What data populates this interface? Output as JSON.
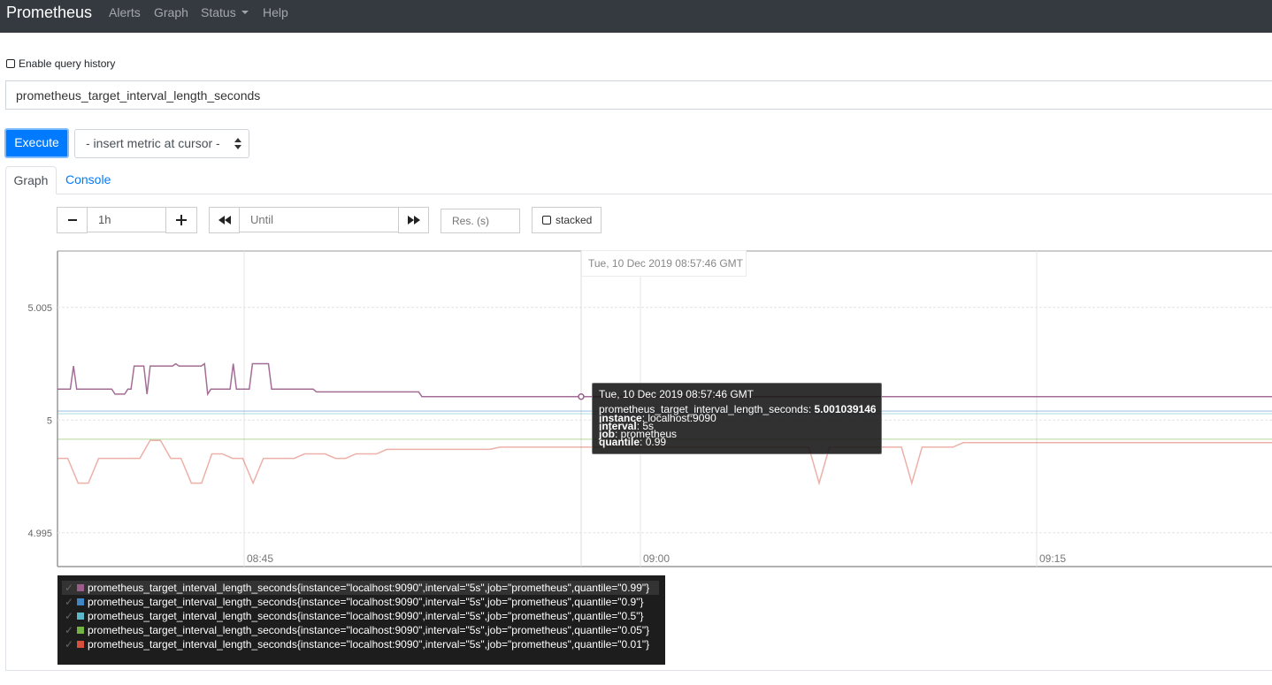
{
  "navbar": {
    "brand": "Prometheus",
    "items": [
      "Alerts",
      "Graph",
      "Status",
      "Help"
    ],
    "bg_color": "#343a40"
  },
  "query": {
    "history_label": "Enable query history",
    "history_checked": false,
    "expression": "prometheus_target_interval_length_seconds",
    "execute_label": "Execute",
    "insert_metric_label": "- insert metric at cursor -"
  },
  "tabs": [
    "Graph",
    "Console"
  ],
  "controls": {
    "range": "1h",
    "until_placeholder": "Until",
    "res_placeholder": "Res. (s)",
    "stacked_label": "stacked"
  },
  "hover_time": "Tue, 10 Dec 2019 08:57:46 GMT",
  "tooltip": {
    "time": "Tue, 10 Dec 2019 08:57:46 GMT",
    "metric": "prometheus_target_interval_length_seconds",
    "value": "5.001039146",
    "labels": [
      {
        "key": "instance",
        "value": "localhost:9090"
      },
      {
        "key": "interval",
        "value": "5s"
      },
      {
        "key": "job",
        "value": "prometheus"
      },
      {
        "key": "quantile",
        "value": "0.99"
      }
    ]
  },
  "legend": [
    {
      "label": "prometheus_target_interval_length_seconds{instance=\"localhost:9090\",interval=\"5s\",job=\"prometheus\",quantile=\"0.99\"}",
      "color": "#9a5d8a"
    },
    {
      "label": "prometheus_target_interval_length_seconds{instance=\"localhost:9090\",interval=\"5s\",job=\"prometheus\",quantile=\"0.9\"}",
      "color": "#3f86c5"
    },
    {
      "label": "prometheus_target_interval_length_seconds{instance=\"localhost:9090\",interval=\"5s\",job=\"prometheus\",quantile=\"0.5\"}",
      "color": "#5bb8c8"
    },
    {
      "label": "prometheus_target_interval_length_seconds{instance=\"localhost:9090\",interval=\"5s\",job=\"prometheus\",quantile=\"0.05\"}",
      "color": "#74b243"
    },
    {
      "label": "prometheus_target_interval_length_seconds{instance=\"localhost:9090\",interval=\"5s\",job=\"prometheus\",quantile=\"0.01\"}",
      "color": "#d6503e"
    }
  ],
  "chart_data": {
    "type": "line",
    "y_ticks": [
      "5.005",
      "5",
      "4.995"
    ],
    "x_ticks": [
      "08:45",
      "09:00",
      "09:15"
    ],
    "ylim": [
      4.9935,
      5.0075
    ],
    "grid": true,
    "series": [
      {
        "name": "quantile=\"0.99\"",
        "color": "#9a5d8a",
        "values": [
          5.00137,
          5.00137,
          5.00137,
          5.00137,
          5.00137,
          5.0024,
          5.00137,
          5.00137,
          5.00137,
          5.00137,
          5.00137,
          5.00137,
          5.00137,
          5.00137,
          5.00137,
          5.00137,
          5.00137,
          5.00137,
          5.00115,
          5.00115,
          5.00115,
          5.00115,
          5.00137,
          5.00137,
          5.0024,
          5.0024,
          5.0024,
          5.0024,
          5.00115,
          5.0024,
          5.0024,
          5.0024,
          5.0024,
          5.0024,
          5.0024,
          5.0024,
          5.0024,
          5.0025,
          5.0024,
          5.0024,
          5.0024,
          5.0024,
          5.0024,
          5.0024,
          5.0024,
          5.0024,
          5.0025,
          5.00115,
          5.00137,
          5.00137,
          5.00137,
          5.00137,
          5.00137,
          5.00137,
          5.00137,
          5.0025,
          5.00137,
          5.00137,
          5.00137,
          5.00137,
          5.00137,
          5.0025,
          5.0025,
          5.0025,
          5.0025,
          5.0025,
          5.0025,
          5.00137,
          5.00137,
          5.00137,
          5.00137,
          5.00137,
          5.00137,
          5.00137,
          5.00137,
          5.00137,
          5.00137,
          5.00137,
          5.00137,
          5.00137,
          5.00137,
          5.00125,
          5.00125,
          5.00125,
          5.00125,
          5.00125,
          5.00125,
          5.00125,
          5.00125,
          5.00125,
          5.00125,
          5.00125,
          5.00125,
          5.00125,
          5.00125,
          5.00125,
          5.00125,
          5.00125,
          5.00125,
          5.00125,
          5.00125,
          5.00125,
          5.00125,
          5.00125,
          5.00125,
          5.00125,
          5.00125,
          5.00125,
          5.00125,
          5.00125,
          5.00125,
          5.00125,
          5.00125,
          5.00125,
          5.00104,
          5.00104,
          5.00104,
          5.00104,
          5.00104,
          5.00104,
          5.00104,
          5.00104,
          5.00104,
          5.00104,
          5.00104,
          5.00104,
          5.00104,
          5.00104,
          5.00104,
          5.00104,
          5.00104,
          5.00104,
          5.00104,
          5.00104,
          5.00104,
          5.00104,
          5.00104,
          5.00104,
          5.00104,
          5.00104,
          5.00104,
          5.00104,
          5.00104,
          5.00104,
          5.00104,
          5.00104,
          5.00104,
          5.00104,
          5.00104,
          5.00104,
          5.00104,
          5.00104,
          5.00104,
          5.00104,
          5.00104,
          5.00104,
          5.00104,
          5.00104,
          5.00104,
          5.00104,
          5.00104,
          5.00104,
          5.00104,
          5.00104,
          5.00104,
          5.00104,
          5.00104,
          5.00104,
          5.00104,
          5.00104,
          5.00104,
          5.00104,
          5.00104,
          5.00104,
          5.00104,
          5.00104,
          5.00104,
          5.00104,
          5.00104,
          5.00104,
          5.00104,
          5.00104,
          5.00104,
          5.00104,
          5.00104,
          5.00104,
          5.00104,
          5.00104,
          5.00104,
          5.00104,
          5.00104,
          5.00104,
          5.00104,
          5.00104,
          5.00104,
          5.00104,
          5.00104,
          5.00104,
          5.00104,
          5.00104,
          5.00104,
          5.00104,
          5.00104,
          5.00104,
          5.00104,
          5.00104,
          5.00104,
          5.00104,
          5.00104,
          5.00104,
          5.00104,
          5.00104,
          5.00104,
          5.00104,
          5.00104,
          5.00104,
          5.00104,
          5.00104,
          5.00104,
          5.00104,
          5.00104,
          5.00104,
          5.00104,
          5.00104,
          5.00104,
          5.00104,
          5.00104,
          5.00104,
          5.00104,
          5.00104,
          5.00104,
          5.00104,
          5.00104,
          5.00104,
          5.00104,
          5.00104,
          5.00104,
          5.00104,
          5.00104,
          5.00104,
          5.00104,
          5.00104,
          5.00104,
          5.00104,
          5.00104,
          5.00104,
          5.00104,
          5.00104,
          5.00104,
          5.00104,
          5.00104,
          5.00104,
          5.00104,
          5.00104,
          5.00104,
          5.00104,
          5.00104,
          5.00104,
          5.00104,
          5.00104,
          5.00104,
          5.00104,
          5.00104,
          5.00104,
          5.00104,
          5.00104,
          5.00104,
          5.00104,
          5.00104,
          5.00104,
          5.00104,
          5.00104,
          5.00104,
          5.00104,
          5.00104,
          5.00104,
          5.00104,
          5.00104,
          5.00104,
          5.00104,
          5.00104,
          5.00104,
          5.00104,
          5.00104,
          5.00104,
          5.00104,
          5.00104,
          5.00104,
          5.00104,
          5.00104,
          5.00104,
          5.00104,
          5.00104,
          5.00104,
          5.00104,
          5.00104,
          5.00104,
          5.00104,
          5.00104,
          5.00104,
          5.00104,
          5.00104,
          5.00104,
          5.00104,
          5.00104,
          5.00104,
          5.00104,
          5.00104,
          5.00104,
          5.00104,
          5.00104,
          5.00104,
          5.00104,
          5.00104,
          5.00104,
          5.00104,
          5.00104,
          5.00104,
          5.00104,
          5.00104,
          5.00104,
          5.00104,
          5.00104,
          5.00104,
          5.00104,
          5.00104,
          5.00104,
          5.00104,
          5.00104,
          5.00104,
          5.00104,
          5.00104,
          5.00104,
          5.00104,
          5.00104,
          5.00104,
          5.00104,
          5.00104,
          5.00104,
          5.00104,
          5.00104,
          5.00104,
          5.00104,
          5.00104,
          5.00104,
          5.00104,
          5.00104,
          5.00104,
          5.00104,
          5.00104,
          5.00104,
          5.00104,
          5.00104,
          5.00104,
          5.00104,
          5.00104,
          5.00104,
          5.00104,
          5.00104,
          5.00104,
          5.00104,
          5.00104,
          5.00104,
          5.00104,
          5.00104,
          5.00104,
          5.00104,
          5.00104,
          5.00104,
          5.00104,
          5.00104,
          5.00104,
          5.00104,
          5.00104,
          5.00104,
          5.00104,
          5.00104,
          5.00104,
          5.00104,
          5.00104,
          5.00104
        ]
      },
      {
        "name": "quantile=\"0.9\"",
        "color": "#3f86c5",
        "values": [
          5.0004,
          5.0004,
          5.0004,
          5.0004,
          5.0004,
          5.0004,
          5.0004,
          5.0004,
          5.0004,
          5.0004,
          5.0004,
          5.0004,
          5.0004,
          5.0004,
          5.0004,
          5.0004,
          5.0004,
          5.0004,
          5.0004,
          5.0004,
          5.0004,
          5.0004,
          5.0004,
          5.0004,
          5.0004,
          5.0004,
          5.0004,
          5.0004,
          5.0004,
          5.0004,
          5.0004,
          5.0004,
          5.0004,
          5.0004,
          5.0004,
          5.0004,
          5.0004,
          5.0004,
          5.0004,
          5.0004
        ]
      },
      {
        "name": "quantile=\"0.5\"",
        "color": "#5bb8c8",
        "values": [
          5.00028,
          5.00028,
          5.00028,
          5.00028,
          5.00028,
          5.00028,
          5.00028,
          5.00028,
          5.00028,
          5.00028,
          5.00028,
          5.00028,
          5.00028,
          5.00028,
          5.00028,
          5.00028,
          5.00028,
          5.00028,
          5.00028,
          5.00028,
          5.00028,
          5.00028,
          5.00028,
          5.00028,
          5.00028,
          5.00028,
          5.00028,
          5.00028,
          5.00028,
          5.00028,
          5.00028,
          5.00028,
          5.00028,
          5.00028,
          5.00028,
          5.00028,
          5.00028,
          5.00028,
          5.00028,
          5.00028
        ]
      },
      {
        "name": "quantile=\"0.05\"",
        "color": "#74b243",
        "values": [
          4.99915,
          4.99915,
          4.99915,
          4.99915,
          4.99915,
          4.99915,
          4.99915,
          4.99915,
          4.99915,
          4.99915,
          4.99915,
          4.99915,
          4.99915,
          4.99915,
          4.99915,
          4.99915,
          4.99915,
          4.99915,
          4.99915,
          4.99915,
          4.99915,
          4.99915,
          4.99915,
          4.99915,
          4.99915,
          4.99915,
          4.99915,
          4.99915,
          4.99915,
          4.99915,
          4.99915,
          4.99915,
          4.99915,
          4.99915,
          4.99915,
          4.99915,
          4.99915,
          4.99915,
          4.99915,
          4.99915
        ]
      },
      {
        "name": "quantile=\"0.01\"",
        "color": "#d6503e",
        "values": [
          4.9983,
          4.9983,
          4.9972,
          4.9972,
          4.9983,
          4.9983,
          4.9983,
          4.9983,
          4.9983,
          4.9991,
          4.9991,
          4.9983,
          4.9983,
          4.9972,
          4.9972,
          4.9985,
          4.9985,
          4.9983,
          4.9983,
          4.9972,
          4.9983,
          4.9983,
          4.9983,
          4.9983,
          4.9985,
          4.9985,
          4.9985,
          4.9983,
          4.9983,
          4.9985,
          4.9985,
          4.9985,
          4.9987,
          4.9987,
          4.9987,
          4.9987,
          4.9987,
          4.9987,
          4.9987,
          4.9987,
          4.9987,
          4.9987,
          4.9987,
          4.9988,
          4.9988,
          4.9988,
          4.9988,
          4.9988,
          4.9988,
          4.9988,
          4.9988,
          4.9988,
          4.9988,
          4.9988,
          4.9988,
          4.9988,
          4.9988,
          4.9988,
          4.9988,
          4.9988,
          4.9988,
          4.9988,
          4.9988,
          4.9988,
          4.9988,
          4.9988,
          4.9988,
          4.9988,
          4.9988,
          4.9988,
          4.9988,
          4.9988,
          4.9988,
          4.9988,
          4.9972,
          4.9988,
          4.9988,
          4.9988,
          4.9988,
          4.9988,
          4.9988,
          4.9988,
          4.9988,
          4.9972,
          4.9988,
          4.9988,
          4.9988,
          4.9988,
          4.999,
          4.999,
          4.999,
          4.999,
          4.999,
          4.999,
          4.999,
          4.999,
          4.999,
          4.999,
          4.999,
          4.999,
          4.999,
          4.999,
          4.999,
          4.999,
          4.999,
          4.999,
          4.999,
          4.999,
          4.999,
          4.999,
          4.999,
          4.999,
          4.999,
          4.999,
          4.999,
          4.999,
          4.999,
          4.999,
          4.999
        ]
      }
    ]
  }
}
